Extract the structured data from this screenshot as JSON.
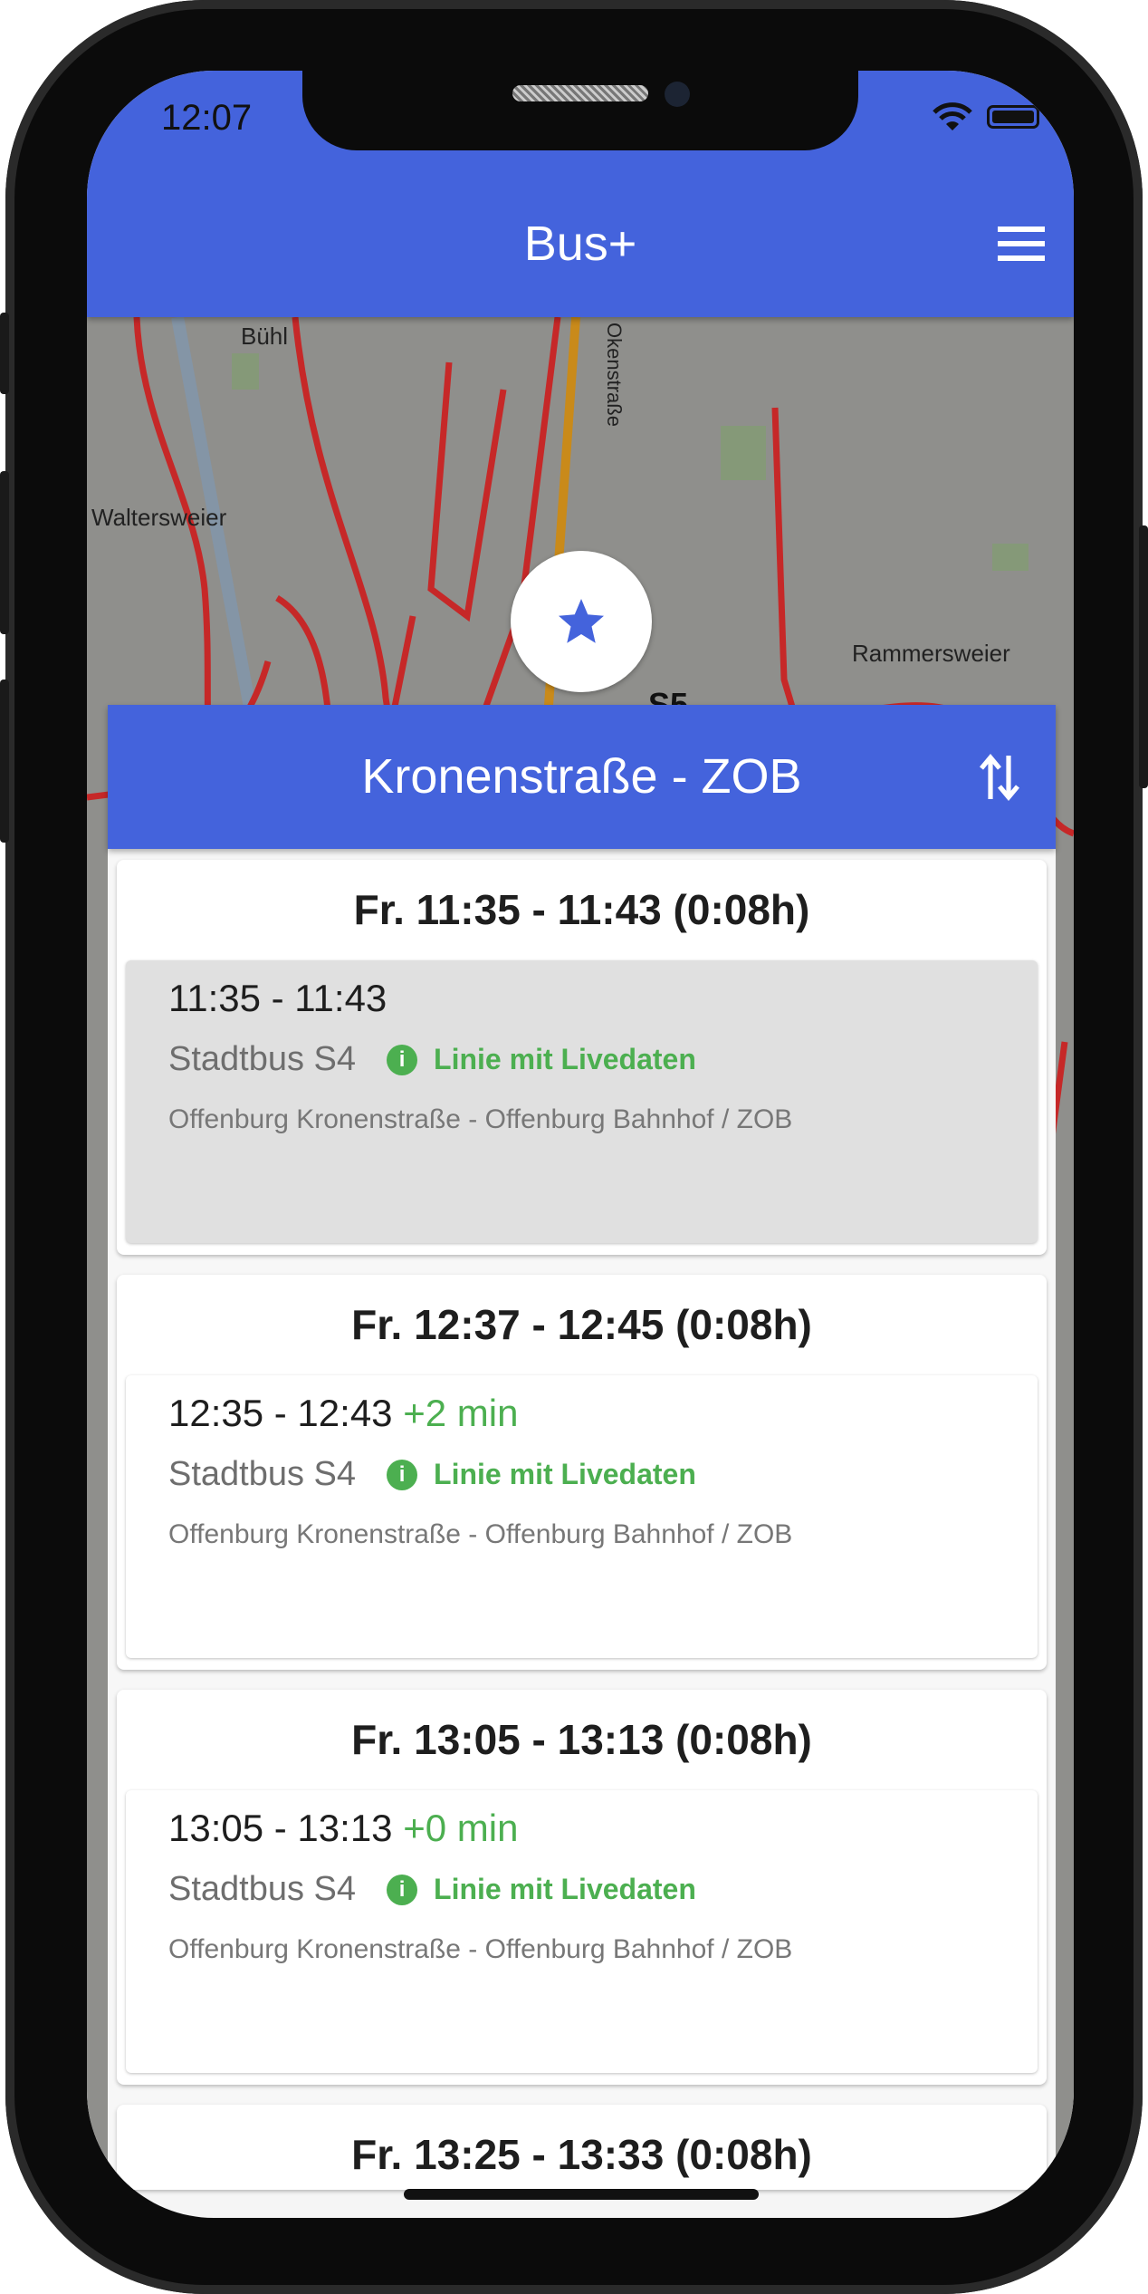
{
  "status_bar": {
    "time": "12:07"
  },
  "app_bar": {
    "title": "Bus+"
  },
  "map": {
    "labels": [
      "Bühl",
      "Waltersweier",
      "Rammersweier",
      "Okenstraße",
      "S5"
    ]
  },
  "route": {
    "title": "Kronenstraße - ZOB"
  },
  "colors": {
    "primary": "#4463dc",
    "live": "#4caf50",
    "route_line": "#c62828"
  },
  "connections": [
    {
      "title": "Fr. 11:35 - 11:43 (0:08h)",
      "legs": [
        {
          "time": "11:35 - 11:43",
          "delay": "",
          "line": "Stadtbus S4",
          "live": "Linie mit Livedaten",
          "route": "Offenburg Kronenstraße - Offenburg Bahnhof / ZOB",
          "selected": true
        }
      ]
    },
    {
      "title": "Fr. 12:37 - 12:45 (0:08h)",
      "legs": [
        {
          "time": "12:35 - 12:43",
          "delay": "+2 min",
          "line": "Stadtbus S4",
          "live": "Linie mit Livedaten",
          "route": "Offenburg Kronenstraße - Offenburg Bahnhof / ZOB",
          "selected": false
        }
      ]
    },
    {
      "title": "Fr. 13:05 - 13:13 (0:08h)",
      "legs": [
        {
          "time": "13:05 - 13:13",
          "delay": "+0 min",
          "line": "Stadtbus S4",
          "live": "Linie mit Livedaten",
          "route": "Offenburg Kronenstraße - Offenburg Bahnhof / ZOB",
          "selected": false
        }
      ]
    },
    {
      "title": "Fr. 13:25 - 13:33 (0:08h)",
      "legs": []
    }
  ]
}
